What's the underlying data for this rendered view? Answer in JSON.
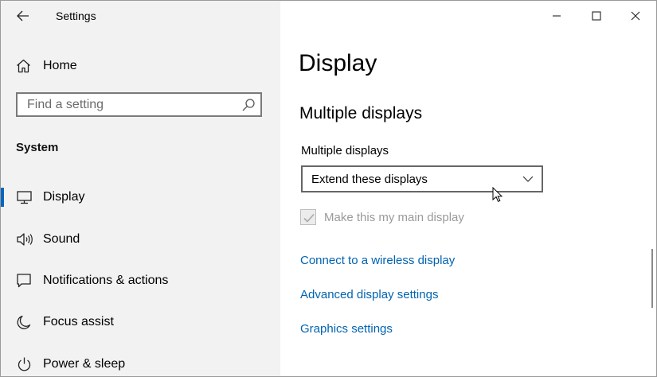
{
  "window": {
    "title": "Settings"
  },
  "sidebar": {
    "home_label": "Home",
    "search_placeholder": "Find a setting",
    "section_heading": "System",
    "items": [
      {
        "label": "Display",
        "icon": "monitor-icon",
        "selected": true
      },
      {
        "label": "Sound",
        "icon": "speaker-icon",
        "selected": false
      },
      {
        "label": "Notifications & actions",
        "icon": "notification-icon",
        "selected": false
      },
      {
        "label": "Focus assist",
        "icon": "moon-icon",
        "selected": false
      },
      {
        "label": "Power & sleep",
        "icon": "power-icon",
        "selected": false
      }
    ]
  },
  "main": {
    "page_title": "Display",
    "section_title": "Multiple displays",
    "dropdown_label": "Multiple displays",
    "dropdown_value": "Extend these displays",
    "checkbox_label": "Make this my main display",
    "checkbox_checked": true,
    "checkbox_disabled": true,
    "links": [
      "Connect to a wireless display",
      "Advanced display settings",
      "Graphics settings"
    ]
  },
  "colors": {
    "accent": "#0067c0",
    "link": "#0063b1",
    "sidebar_bg": "#f2f2f2",
    "disabled_text": "#9a9a9a"
  }
}
